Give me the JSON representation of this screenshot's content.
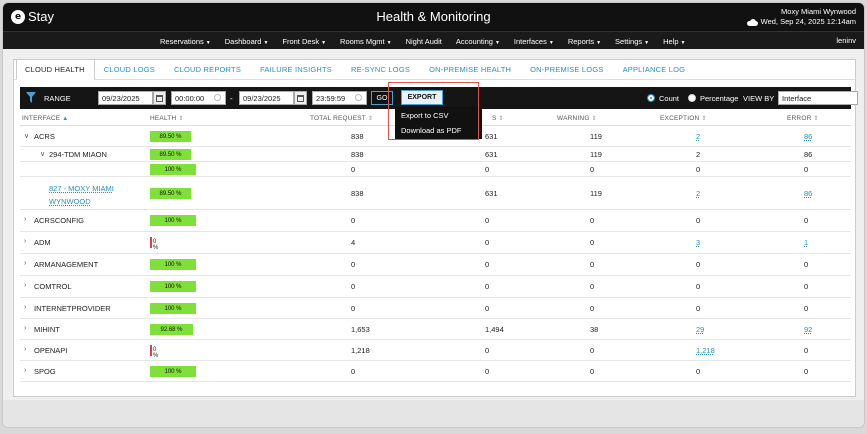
{
  "header": {
    "logo_letter": "e",
    "logo_text": "Stay",
    "title": "Health & Monitoring",
    "hotel_name": "Moxy Miami Wynwood",
    "date": "Wed, Sep 24, 2025 12:14am"
  },
  "nav": {
    "items": [
      {
        "label": "Reservations",
        "caret": true
      },
      {
        "label": "Dashboard",
        "caret": true
      },
      {
        "label": "Front Desk",
        "caret": true
      },
      {
        "label": "Rooms Mgmt",
        "caret": true
      },
      {
        "label": "Night Audit",
        "caret": false
      },
      {
        "label": "Accounting",
        "caret": true
      },
      {
        "label": "Interfaces",
        "caret": true
      },
      {
        "label": "Reports",
        "caret": true
      },
      {
        "label": "Settings",
        "caret": true
      },
      {
        "label": "Help",
        "caret": true
      }
    ],
    "user": "leninv"
  },
  "tabs": [
    "CLOUD HEALTH",
    "CLOUD LOGS",
    "CLOUD REPORTS",
    "FAILURE INSIGHTS",
    "RE-SYNC LOGS",
    "ON-PREMISE HEALTH",
    "ON-PREMISE LOGS",
    "APPLIANCE LOG"
  ],
  "filters": {
    "range_label": "RANGE",
    "start_date": "09/23/2025",
    "start_time": "00:00:00",
    "end_date": "09/23/2025",
    "end_time": "23:59:59",
    "separator": "-",
    "go_label": "GO",
    "export_label": "EXPORT",
    "count_label": "Count",
    "percentage_label": "Percentage",
    "view_by_label": "VIEW BY",
    "view_by_value": "Interface"
  },
  "export_menu": [
    "Export to CSV",
    "Download as PDF"
  ],
  "columns": {
    "interface": "INTERFACE",
    "health": "HEALTH",
    "total_request": "TOTAL REQUEST",
    "success_partial": "S",
    "warning": "WARNING",
    "exception": "EXCEPTION",
    "error": "ERROR"
  },
  "rows": [
    {
      "name": "ACRS",
      "level": 0,
      "chevron": "down",
      "health_pct": 89.5,
      "health": "89.50 %",
      "total": "838",
      "success": "631",
      "warning": "119",
      "exception": "2",
      "error": "86",
      "exc_link": true,
      "err_link": true
    },
    {
      "name": "294-TDM MIAON",
      "level": 1,
      "chevron": "down",
      "health_pct": 89.5,
      "health": "89.50 %",
      "total": "838",
      "success": "631",
      "warning": "119",
      "exception": "2",
      "error": "86",
      "exc_link": false,
      "err_link": false
    },
    {
      "name": "",
      "level": 2,
      "chevron": "",
      "health_pct": 100,
      "health": "100 %",
      "total": "0",
      "success": "0",
      "warning": "0",
      "exception": "0",
      "error": "0",
      "exc_link": false,
      "err_link": false
    },
    {
      "name": "827 - MOXY MIAMI WYNWOOD",
      "name_line1": "827 - MOXY MIAMI",
      "name_line2": "WYNWOOD",
      "level": 2,
      "chevron": "",
      "health_pct": 89.5,
      "health": "89.50 %",
      "total": "838",
      "success": "631",
      "warning": "119",
      "exception": "2",
      "error": "86",
      "exc_link": true,
      "err_link": true,
      "name_link": true
    },
    {
      "name": "ACRSCONFIG",
      "level": 0,
      "chevron": "right",
      "health_pct": 100,
      "health": "100 %",
      "total": "0",
      "success": "0",
      "warning": "0",
      "exception": "0",
      "error": "0",
      "exc_link": false,
      "err_link": false
    },
    {
      "name": "ADM",
      "level": 0,
      "chevron": "right",
      "health_pct": 0,
      "health": "0 %",
      "total": "4",
      "success": "0",
      "warning": "0",
      "exception": "3",
      "error": "1",
      "exc_link": true,
      "err_link": true
    },
    {
      "name": "ARMANAGEMENT",
      "level": 0,
      "chevron": "right",
      "health_pct": 100,
      "health": "100 %",
      "total": "0",
      "success": "0",
      "warning": "0",
      "exception": "0",
      "error": "0",
      "exc_link": false,
      "err_link": false
    },
    {
      "name": "COMTROL",
      "level": 0,
      "chevron": "right",
      "health_pct": 100,
      "health": "100 %",
      "total": "0",
      "success": "0",
      "warning": "0",
      "exception": "0",
      "error": "0",
      "exc_link": false,
      "err_link": false
    },
    {
      "name": "INTERNETPROVIDER",
      "level": 0,
      "chevron": "right",
      "health_pct": 100,
      "health": "100 %",
      "total": "0",
      "success": "0",
      "warning": "0",
      "exception": "0",
      "error": "0",
      "exc_link": false,
      "err_link": false
    },
    {
      "name": "MIHINT",
      "level": 0,
      "chevron": "right",
      "health_pct": 92.68,
      "health": "92.68 %",
      "total": "1,653",
      "success": "1,494",
      "warning": "38",
      "exception": "29",
      "error": "92",
      "exc_link": true,
      "err_link": true
    },
    {
      "name": "OPENAPI",
      "level": 0,
      "chevron": "right",
      "health_pct": 0,
      "health": "0 %",
      "total": "1,218",
      "success": "0",
      "warning": "0",
      "exception": "1,218",
      "error": "0",
      "exc_link": true,
      "err_link": false
    },
    {
      "name": "SPOG",
      "level": 0,
      "chevron": "right",
      "health_pct": 100,
      "health": "100 %",
      "total": "0",
      "success": "0",
      "warning": "0",
      "exception": "0",
      "error": "0",
      "exc_link": false,
      "err_link": false
    }
  ],
  "colors": {
    "health_bar": "#7fe03a",
    "zero_health": "#e04040",
    "link": "#2a8fc0",
    "highlight": "#d9534f"
  }
}
